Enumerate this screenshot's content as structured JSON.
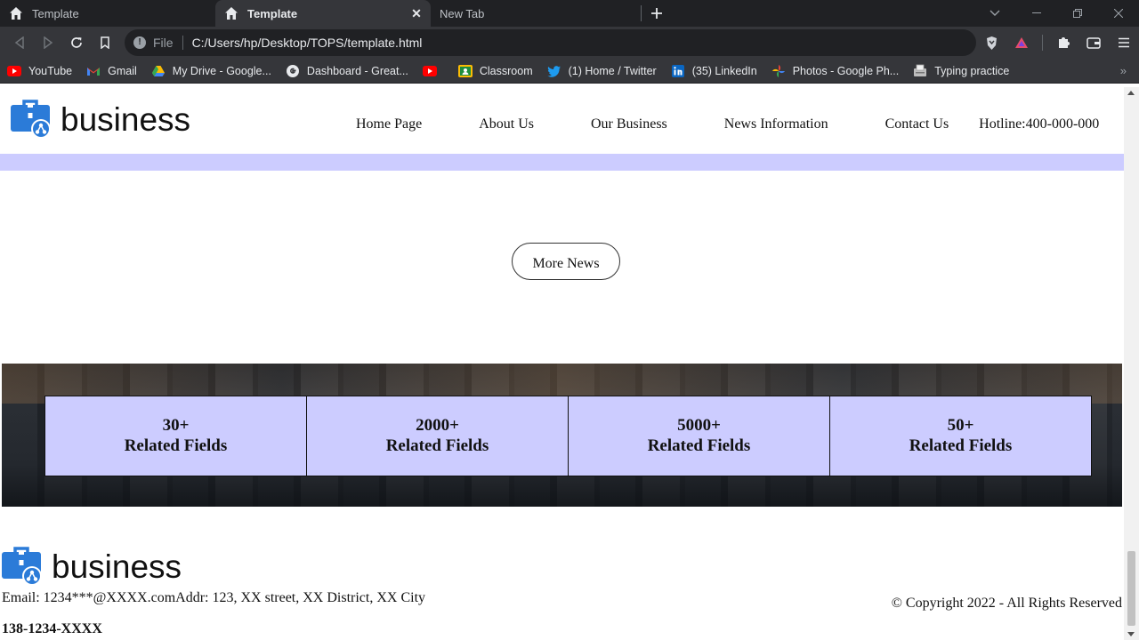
{
  "browser": {
    "tabs": [
      {
        "label": "Template",
        "active": false
      },
      {
        "label": "Template",
        "active": true
      },
      {
        "label": "New Tab",
        "active": false
      }
    ],
    "address": {
      "scheme": "File",
      "url": "C:/Users/hp/Desktop/TOPS/template.html"
    },
    "bookmarks": [
      {
        "label": "YouTube",
        "icon": "youtube-icon"
      },
      {
        "label": "Gmail",
        "icon": "gmail-icon"
      },
      {
        "label": "My Drive - Google...",
        "icon": "drive-icon"
      },
      {
        "label": "Dashboard - Great...",
        "icon": "google-icon"
      },
      {
        "label": "",
        "icon": "youtube-icon"
      },
      {
        "label": "Classroom",
        "icon": "classroom-icon"
      },
      {
        "label": "(1) Home / Twitter",
        "icon": "twitter-icon"
      },
      {
        "label": "(35) LinkedIn",
        "icon": "linkedin-icon"
      },
      {
        "label": "Photos - Google Ph...",
        "icon": "photos-icon"
      },
      {
        "label": "Typing practice",
        "icon": "typing-icon"
      }
    ]
  },
  "page": {
    "brand": "business",
    "nav": [
      "Home Page",
      "About Us",
      "Our Business",
      "News Information",
      "Contact Us"
    ],
    "hotline": "Hotline:400-000-000",
    "more_news": "More News",
    "stats": [
      {
        "value": "30+",
        "label": "Related Fields"
      },
      {
        "value": "2000+",
        "label": "Related Fields"
      },
      {
        "value": "5000+",
        "label": "Related Fields"
      },
      {
        "value": "50+",
        "label": "Related Fields"
      }
    ],
    "footer": {
      "brand": "business",
      "email_addr": "Email: 1234***@XXXX.comAddr: 123, XX street, XX District, XX City",
      "copyright": "© Copyright 2022 - All Rights Reserved",
      "phone": "138-1234-XXXX"
    }
  },
  "colors": {
    "accent": "#ccccff",
    "logo": "#2b7bd8"
  }
}
